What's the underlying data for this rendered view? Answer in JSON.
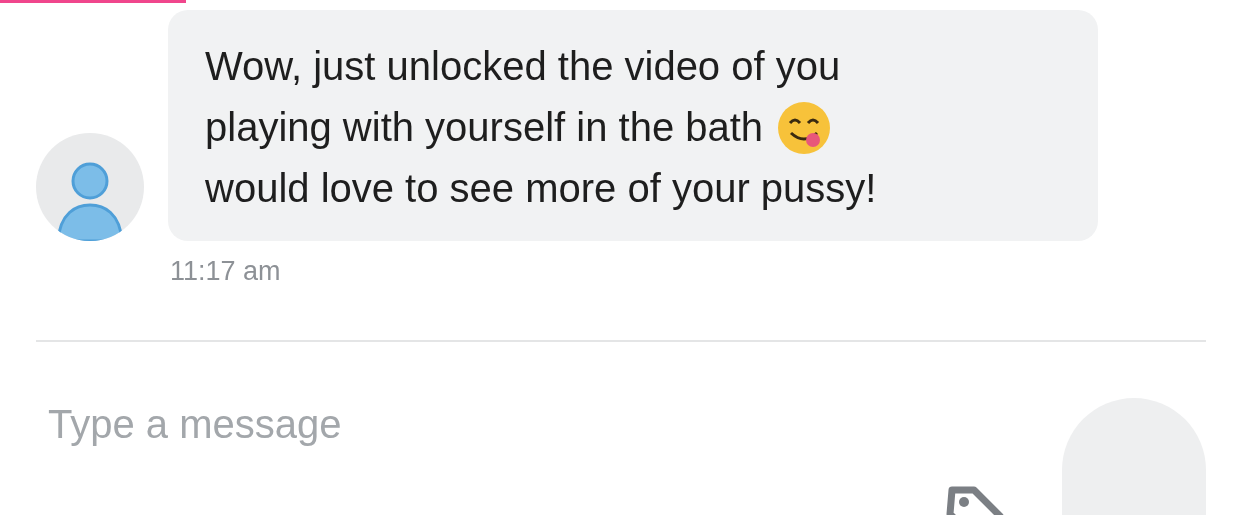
{
  "message": {
    "lines": [
      "Wow, just unlocked the video of you",
      "playing with yourself in the bath",
      "would love to see more of your pussy!"
    ],
    "time": "11:17 am"
  },
  "composer": {
    "placeholder": "Type a message"
  }
}
